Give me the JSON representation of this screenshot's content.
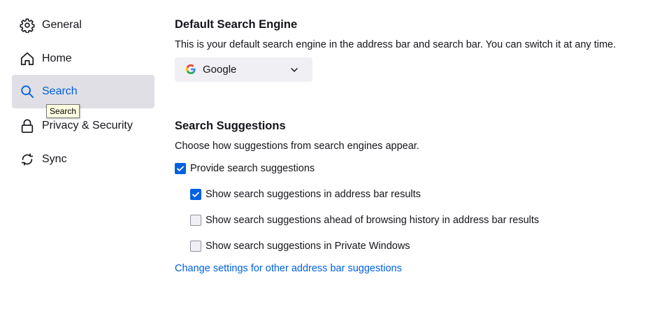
{
  "sidebar": {
    "items": [
      {
        "label": "General",
        "icon": "gear-icon"
      },
      {
        "label": "Home",
        "icon": "home-icon"
      },
      {
        "label": "Search",
        "icon": "search-icon",
        "selected": true
      },
      {
        "label": "Privacy & Security",
        "icon": "lock-icon"
      },
      {
        "label": "Sync",
        "icon": "sync-icon"
      }
    ],
    "tooltip": "Search"
  },
  "default_engine": {
    "heading": "Default Search Engine",
    "description": "This is your default search engine in the address bar and search bar. You can switch it at any time.",
    "selected_engine": "Google"
  },
  "suggestions": {
    "heading": "Search Suggestions",
    "description": "Choose how suggestions from search engines appear.",
    "options": [
      {
        "label": "Provide search suggestions",
        "checked": true
      },
      {
        "label": "Show search suggestions in address bar results",
        "checked": true
      },
      {
        "label": "Show search suggestions ahead of browsing history in address bar results",
        "checked": false
      },
      {
        "label": "Show search suggestions in Private Windows",
        "checked": false
      }
    ],
    "link": "Change settings for other address bar suggestions"
  },
  "colors": {
    "accent": "#0061e0",
    "selected_bg": "#e0dfe6",
    "text": "#15141a"
  }
}
